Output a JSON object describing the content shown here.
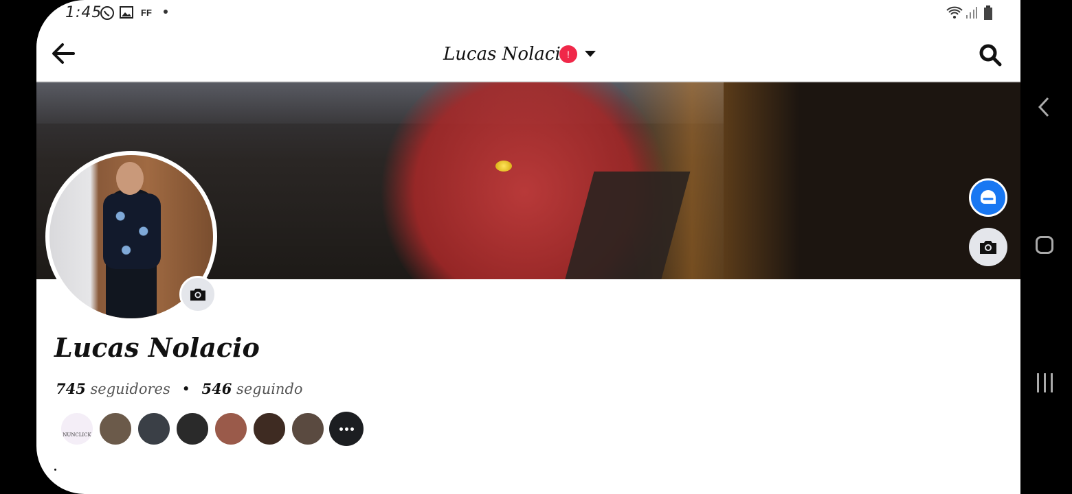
{
  "status_bar": {
    "time": "1:45",
    "icons": [
      "whatsapp-icon",
      "gallery-icon",
      "ff-icon",
      "dot-icon",
      "wifi-icon",
      "signal-icon",
      "battery-icon"
    ],
    "ff_label": "FF"
  },
  "header": {
    "title": "Lucas Nolacio",
    "badge": "!",
    "back_icon": "arrow-left-icon",
    "search_icon": "search-icon"
  },
  "cover": {
    "buttons": [
      "messenger-icon",
      "camera-icon"
    ]
  },
  "profile": {
    "name": "Lucas Nolacio",
    "followers_count": "745",
    "followers_label": "seguidores",
    "following_count": "546",
    "following_label": "seguindo",
    "separator": "•",
    "bio": "."
  },
  "follower_avatars": [
    {
      "label": "NUNCLICK",
      "color": "#e9d7f2"
    },
    {
      "color": "#6b5a4a"
    },
    {
      "color": "#3a3f46"
    },
    {
      "color": "#2a2a2a"
    },
    {
      "color": "#9a5a4a"
    },
    {
      "color": "#3e2b22"
    },
    {
      "color": "#5a4a40"
    }
  ],
  "colors": {
    "accent": "#1877f2",
    "badge": "#f02849"
  }
}
